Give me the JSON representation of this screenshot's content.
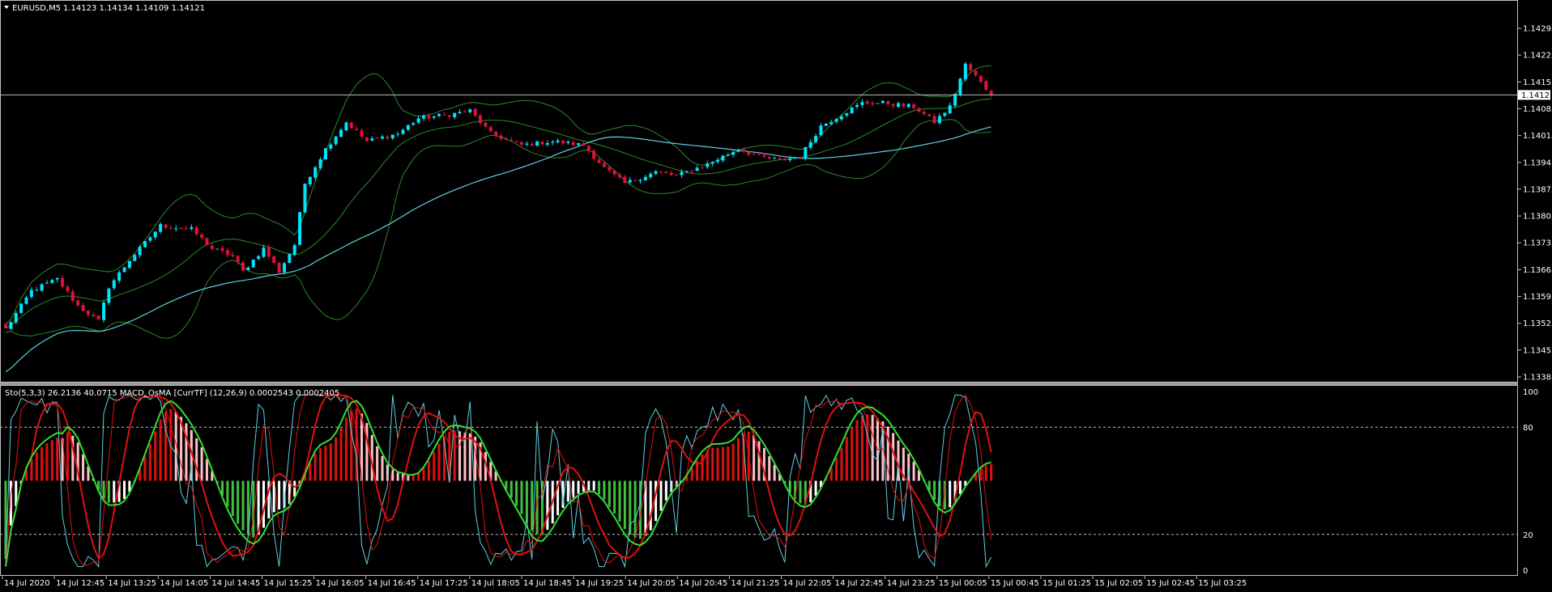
{
  "main_chart": {
    "symbol_label": "EURUSD,M5",
    "ohlc_label": "1.14123 1.14134 1.14109 1.14121",
    "current_price": "1.14121",
    "price_ticks": [
      "1.14295",
      "1.14225",
      "1.14155",
      "1.14085",
      "1.14015",
      "1.13945",
      "1.13875",
      "1.13805",
      "1.13735",
      "1.13665",
      "1.13595",
      "1.13525",
      "1.13455",
      "1.13385"
    ]
  },
  "sub_chart": {
    "indicator_label": "Sto(5,3,3) 26.2136 40.0715  MACD_OsMA [CurrTF] (12,26,9) 0.0002543 0.0002405",
    "level_ticks": [
      "100",
      "80",
      "20",
      "0"
    ]
  },
  "time_axis": {
    "labels": [
      "14 Jul 2020",
      "14 Jul 12:45",
      "14 Jul 13:25",
      "14 Jul 14:05",
      "14 Jul 14:45",
      "14 Jul 15:25",
      "14 Jul 16:05",
      "14 Jul 16:45",
      "14 Jul 17:25",
      "14 Jul 18:05",
      "14 Jul 18:45",
      "14 Jul 19:25",
      "14 Jul 20:05",
      "14 Jul 20:45",
      "14 Jul 21:25",
      "14 Jul 22:05",
      "14 Jul 22:45",
      "14 Jul 23:25",
      "15 Jul 00:05",
      "15 Jul 00:45",
      "15 Jul 01:25",
      "15 Jul 02:05",
      "15 Jul 02:45",
      "15 Jul 03:25"
    ]
  },
  "colors": {
    "bull": "#00e5ff",
    "bear": "#e0103a",
    "frame": "#c0c0c0",
    "bands": "#2a8a2a",
    "ma": "#5fd0e0",
    "hist_up_strong": "#e01010",
    "hist_up_weak": "#ffc0c8",
    "hist_down_strong": "#40c040",
    "hist_down_weak": "#ffffff",
    "sto_main": "#e01010",
    "sto_signal": "#30e030"
  },
  "chart_data": {
    "type": "candlestick",
    "price_range": [
      1.13385,
      1.14295
    ],
    "last_close": 1.14121,
    "oscillator_range": [
      0,
      100
    ],
    "oscillator_levels": [
      80,
      20
    ],
    "anchors_close": [
      [
        0,
        1.1351
      ],
      [
        5,
        1.1361
      ],
      [
        10,
        1.1364
      ],
      [
        14,
        1.1357
      ],
      [
        18,
        1.1353
      ],
      [
        20,
        1.1362
      ],
      [
        24,
        1.1369
      ],
      [
        30,
        1.1378
      ],
      [
        36,
        1.1377
      ],
      [
        40,
        1.1372
      ],
      [
        44,
        1.137
      ],
      [
        46,
        1.1366
      ],
      [
        50,
        1.1372
      ],
      [
        53,
        1.1366
      ],
      [
        56,
        1.1373
      ],
      [
        58,
        1.1389
      ],
      [
        62,
        1.1398
      ],
      [
        66,
        1.1405
      ],
      [
        70,
        1.14
      ],
      [
        76,
        1.1402
      ],
      [
        80,
        1.1406
      ],
      [
        86,
        1.1407
      ],
      [
        90,
        1.1408
      ],
      [
        94,
        1.1402
      ],
      [
        100,
        1.1399
      ],
      [
        106,
        1.14
      ],
      [
        112,
        1.1399
      ],
      [
        116,
        1.1393
      ],
      [
        120,
        1.1389
      ],
      [
        126,
        1.1392
      ],
      [
        130,
        1.1391
      ],
      [
        136,
        1.1394
      ],
      [
        142,
        1.1398
      ],
      [
        146,
        1.1396
      ],
      [
        150,
        1.1395
      ],
      [
        154,
        1.1396
      ],
      [
        158,
        1.1404
      ],
      [
        162,
        1.1407
      ],
      [
        166,
        1.141
      ],
      [
        170,
        1.141
      ],
      [
        176,
        1.1409
      ],
      [
        180,
        1.1405
      ],
      [
        183,
        1.1409
      ],
      [
        186,
        1.142
      ],
      [
        188,
        1.1417
      ],
      [
        191,
        1.1412
      ]
    ]
  }
}
